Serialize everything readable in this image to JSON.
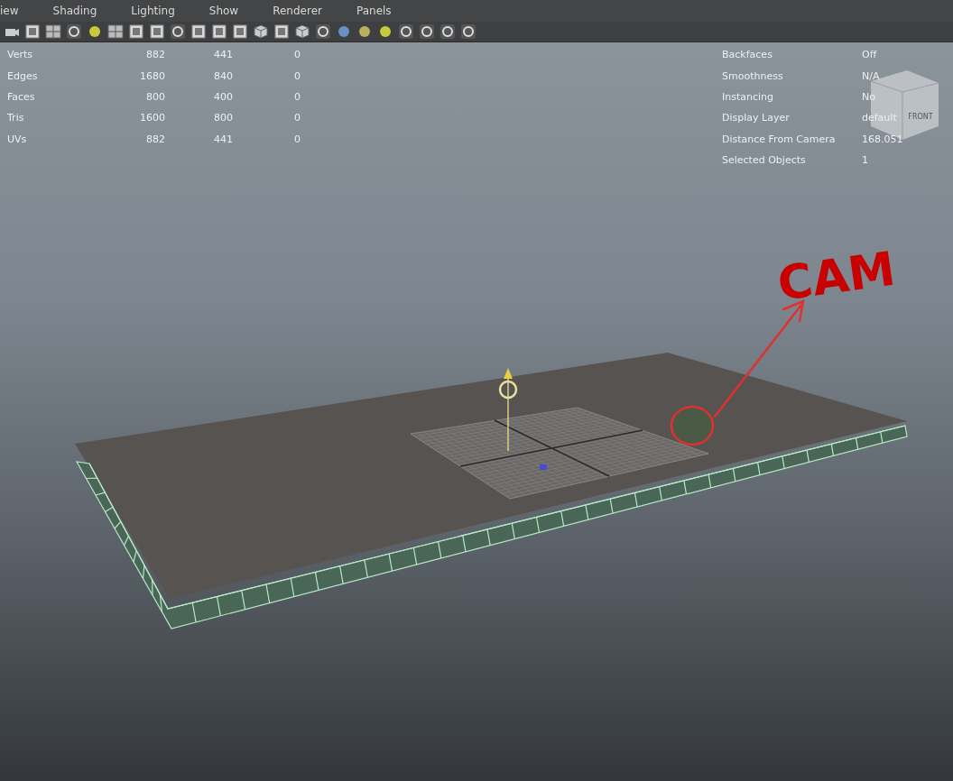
{
  "menu": [
    "iew",
    "Shading",
    "Lighting",
    "Show",
    "Renderer",
    "Panels"
  ],
  "hud_left": [
    {
      "label": "Verts",
      "values": [
        "882",
        "441",
        "0"
      ]
    },
    {
      "label": "Edges",
      "values": [
        "1680",
        "840",
        "0"
      ]
    },
    {
      "label": "Faces",
      "values": [
        "800",
        "400",
        "0"
      ]
    },
    {
      "label": "Tris",
      "values": [
        "1600",
        "800",
        "0"
      ]
    },
    {
      "label": "UVs",
      "values": [
        "882",
        "441",
        "0"
      ]
    }
  ],
  "hud_right": [
    {
      "label": "Backfaces",
      "value": "Off"
    },
    {
      "label": "Smoothness",
      "value": "N/A"
    },
    {
      "label": "Instancing",
      "value": "No"
    },
    {
      "label": "Display Layer",
      "value": "default"
    },
    {
      "label": "Distance From Camera",
      "value": "168.051"
    },
    {
      "label": "Selected Objects",
      "value": "1"
    }
  ],
  "view_cube": {
    "label": "FRONT"
  },
  "annotation": {
    "text": "CAM"
  }
}
